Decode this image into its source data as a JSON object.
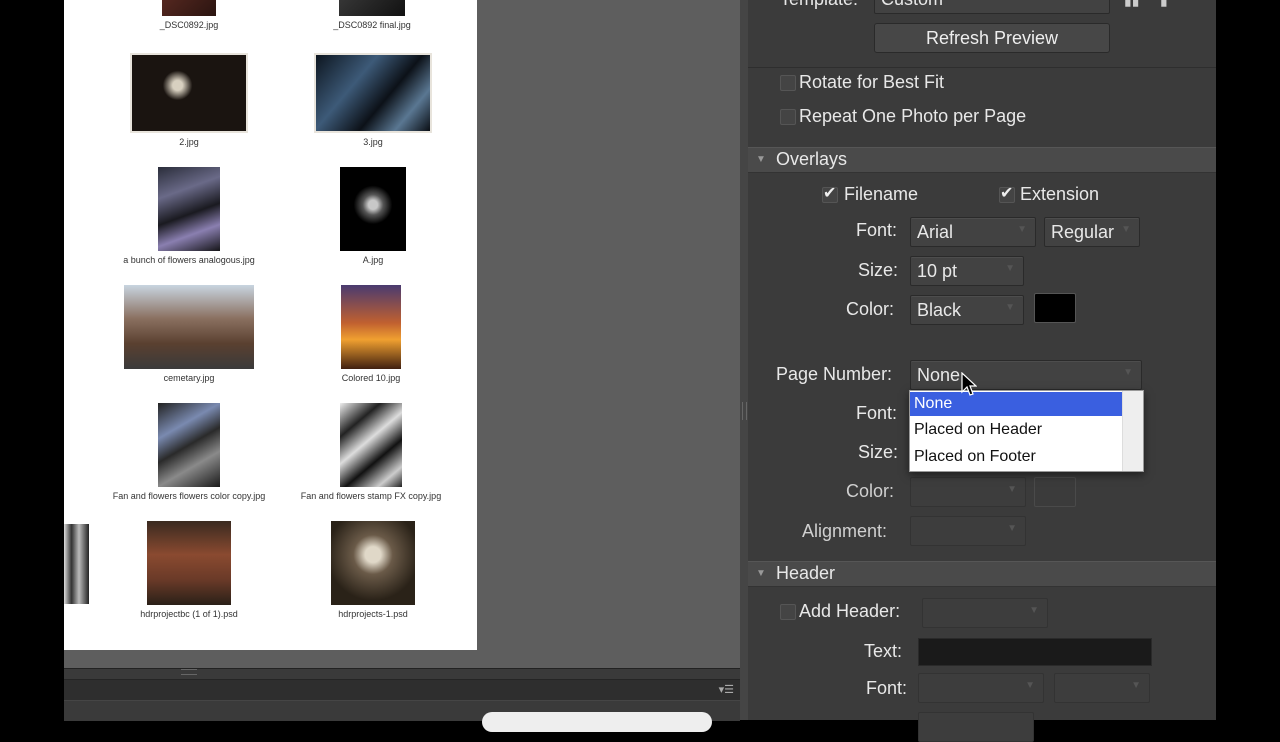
{
  "thumbnails": [
    {
      "caption": "_DSC0892.jpg"
    },
    {
      "caption": "_DSC0892 final.jpg"
    },
    {
      "caption": "2.jpg"
    },
    {
      "caption": "3.jpg"
    },
    {
      "caption": "a bunch of flowers analogous.jpg"
    },
    {
      "caption": "A.jpg"
    },
    {
      "caption": "cemetary.jpg"
    },
    {
      "caption": "Colored 10.jpg"
    },
    {
      "caption": "Fan and flowers flowers color copy.jpg"
    },
    {
      "caption": "Fan and flowers stamp FX copy.jpg"
    },
    {
      "caption": "hdrprojectbc (1 of 1).psd"
    },
    {
      "caption": "hdrprojects-1.psd"
    }
  ],
  "panel": {
    "template_label": "Template:",
    "template_value": "Custom",
    "refresh_label": "Refresh Preview",
    "rotate_label": "Rotate for Best Fit",
    "repeat_label": "Repeat One Photo per Page",
    "overlays": {
      "title": "Overlays",
      "filename_label": "Filename",
      "extension_label": "Extension",
      "font_label": "Font:",
      "font_value": "Arial",
      "style_value": "Regular",
      "size_label": "Size:",
      "size_value": "10 pt",
      "color_label": "Color:",
      "color_value": "Black",
      "swatch_color": "#000000",
      "page_number_label": "Page Number:",
      "page_number_value": "None",
      "pn_font_label": "Font:",
      "pn_size_label": "Size:",
      "pn_color_label": "Color:",
      "pn_alignment_label": "Alignment:"
    },
    "page_number_options": [
      "None",
      "Placed on Header",
      "Placed on Footer"
    ],
    "header": {
      "title": "Header",
      "add_header_label": "Add Header:",
      "text_label": "Text:",
      "font_label": "Font:"
    }
  },
  "colors": {
    "selection_blue": "#3a5fe0",
    "panel_bg": "#3b3b3b"
  }
}
